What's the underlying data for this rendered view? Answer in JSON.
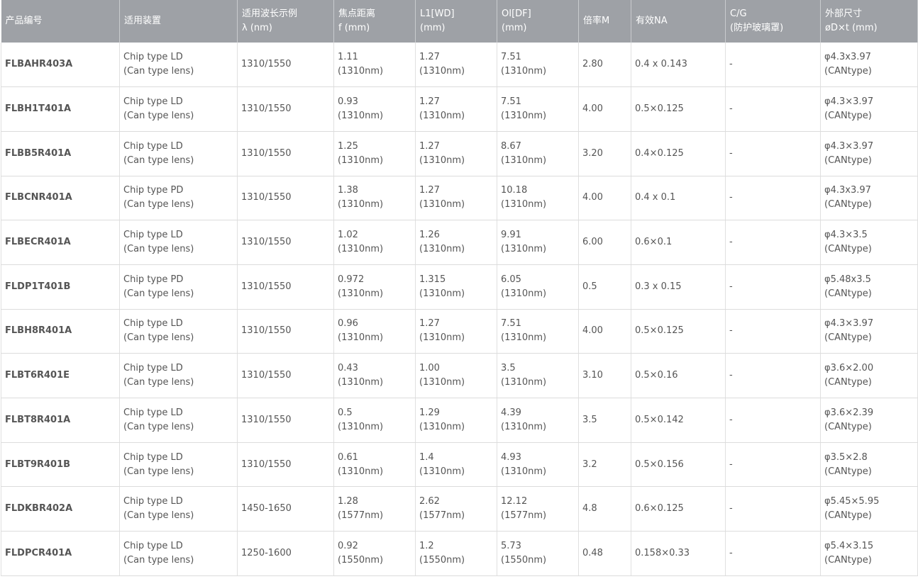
{
  "headers": [
    {
      "l1": "产品编号",
      "l2": ""
    },
    {
      "l1": "适用装置",
      "l2": ""
    },
    {
      "l1": "适用波长示例",
      "l2": "λ (nm)"
    },
    {
      "l1": "焦点距离",
      "l2": "f (mm)"
    },
    {
      "l1": "L1[WD]",
      "l2": "(mm)"
    },
    {
      "l1": "OI[DF]",
      "l2": "(mm)"
    },
    {
      "l1": "倍率M",
      "l2": ""
    },
    {
      "l1": "有效NA",
      "l2": ""
    },
    {
      "l1": "C/G",
      "l2": "(防护玻璃罩)"
    },
    {
      "l1": "外部尺寸",
      "l2": "øD×t (mm)"
    }
  ],
  "rows": [
    {
      "pn": "FLBAHR403A",
      "dev": [
        "Chip type LD",
        "(Can type lens)"
      ],
      "wl": "1310/1550",
      "f": [
        "1.11",
        "(1310nm)"
      ],
      "l1": [
        "1.27",
        "(1310nm)"
      ],
      "oi": [
        "7.51",
        "(1310nm)"
      ],
      "m": "2.80",
      "na": "0.4 x 0.143",
      "cg": "-",
      "dim": [
        "φ4.3x3.97",
        "(CANtype)"
      ]
    },
    {
      "pn": "FLBH1T401A",
      "dev": [
        "Chip type LD",
        "(Can type lens)"
      ],
      "wl": "1310/1550",
      "f": [
        "0.93",
        "(1310nm)"
      ],
      "l1": [
        "1.27",
        "(1310nm)"
      ],
      "oi": [
        "7.51",
        "(1310nm)"
      ],
      "m": "4.00",
      "na": "0.5×0.125",
      "cg": "-",
      "dim": [
        "φ4.3×3.97",
        "(CANtype)"
      ]
    },
    {
      "pn": "FLBB5R401A",
      "dev": [
        "Chip type LD",
        "(Can type lens)"
      ],
      "wl": "1310/1550",
      "f": [
        "1.25",
        "(1310nm)"
      ],
      "l1": [
        "1.27",
        "(1310nm)"
      ],
      "oi": [
        "8.67",
        "(1310nm)"
      ],
      "m": "3.20",
      "na": "0.4×0.125",
      "cg": "-",
      "dim": [
        "φ4.3×3.97",
        "(CANtype)"
      ]
    },
    {
      "pn": "FLBCNR401A",
      "dev": [
        "Chip type PD",
        "(Can type lens)"
      ],
      "wl": "1310/1550",
      "f": [
        "1.38",
        "(1310nm)"
      ],
      "l1": [
        "1.27",
        "(1310nm)"
      ],
      "oi": [
        "10.18",
        "(1310nm)"
      ],
      "m": "4.00",
      "na": "0.4 x 0.1",
      "cg": "-",
      "dim": [
        "φ4.3x3.97",
        "(CANtype)"
      ]
    },
    {
      "pn": "FLBECR401A",
      "dev": [
        "Chip type LD",
        "(Can type lens)"
      ],
      "wl": "1310/1550",
      "f": [
        "1.02",
        "(1310nm)"
      ],
      "l1": [
        "1.26",
        "(1310nm)"
      ],
      "oi": [
        "9.91",
        "(1310nm)"
      ],
      "m": "6.00",
      "na": "0.6×0.1",
      "cg": "-",
      "dim": [
        "φ4.3×3.5",
        "(CANtype)"
      ]
    },
    {
      "pn": "FLDP1T401B",
      "dev": [
        "Chip type PD",
        "(Can type lens)"
      ],
      "wl": "1310/1550",
      "f": [
        "0.972",
        "(1310nm)"
      ],
      "l1": [
        "1.315",
        "(1310nm)"
      ],
      "oi": [
        "6.05",
        "(1310nm)"
      ],
      "m": "0.5",
      "na": "0.3 x 0.15",
      "cg": "-",
      "dim": [
        "φ5.48x3.5",
        "(CANtype)"
      ]
    },
    {
      "pn": "FLBH8R401A",
      "dev": [
        "Chip type LD",
        "(Can type lens)"
      ],
      "wl": "1310/1550",
      "f": [
        "0.96",
        "(1310nm)"
      ],
      "l1": [
        "1.27",
        "(1310nm)"
      ],
      "oi": [
        "7.51",
        "(1310nm)"
      ],
      "m": "4.00",
      "na": "0.5×0.125",
      "cg": "-",
      "dim": [
        "φ4.3×3.97",
        "(CANtype)"
      ]
    },
    {
      "pn": "FLBT6R401E",
      "dev": [
        "Chip type LD",
        "(Can type lens)"
      ],
      "wl": "1310/1550",
      "f": [
        "0.43",
        "(1310nm)"
      ],
      "l1": [
        "1.00",
        "(1310nm)"
      ],
      "oi": [
        "3.5",
        "(1310nm)"
      ],
      "m": "3.10",
      "na": "0.5×0.16",
      "cg": "-",
      "dim": [
        "φ3.6×2.00",
        "(CANtype)"
      ]
    },
    {
      "pn": "FLBT8R401A",
      "dev": [
        "Chip type LD",
        "(Can type lens)"
      ],
      "wl": "1310/1550",
      "f": [
        "0.5",
        "(1310nm)"
      ],
      "l1": [
        "1.29",
        "(1310nm)"
      ],
      "oi": [
        "4.39",
        "(1310nm)"
      ],
      "m": "3.5",
      "na": "0.5×0.142",
      "cg": "-",
      "dim": [
        "φ3.6×2.39",
        "(CANtype)"
      ]
    },
    {
      "pn": "FLBT9R401B",
      "dev": [
        "Chip type LD",
        "(Can type lens)"
      ],
      "wl": "1310/1550",
      "f": [
        "0.61",
        "(1310nm)"
      ],
      "l1": [
        "1.4",
        "(1310nm)"
      ],
      "oi": [
        "4.93",
        "(1310nm)"
      ],
      "m": "3.2",
      "na": "0.5×0.156",
      "cg": "-",
      "dim": [
        "φ3.5×2.8",
        "(CANtype)"
      ]
    },
    {
      "pn": "FLDKBR402A",
      "dev": [
        "Chip type LD",
        "(Can type lens)"
      ],
      "wl": "1450-1650",
      "f": [
        "1.28",
        "(1577nm)"
      ],
      "l1": [
        "2.62",
        "(1577nm)"
      ],
      "oi": [
        "12.12",
        "(1577nm)"
      ],
      "m": "4.8",
      "na": "0.6×0.125",
      "cg": "-",
      "dim": [
        "φ5.45×5.95",
        "(CANtype)"
      ]
    },
    {
      "pn": "FLDPCR401A",
      "dev": [
        "Chip type LD",
        "(Can type lens)"
      ],
      "wl": "1250-1600",
      "f": [
        "0.92",
        "(1550nm)"
      ],
      "l1": [
        "1.2",
        "(1550nm)"
      ],
      "oi": [
        "5.73",
        "(1550nm)"
      ],
      "m": "0.48",
      "na": "0.158×0.33",
      "cg": "-",
      "dim": [
        "φ5.4×3.15",
        "(CANtype)"
      ]
    }
  ]
}
